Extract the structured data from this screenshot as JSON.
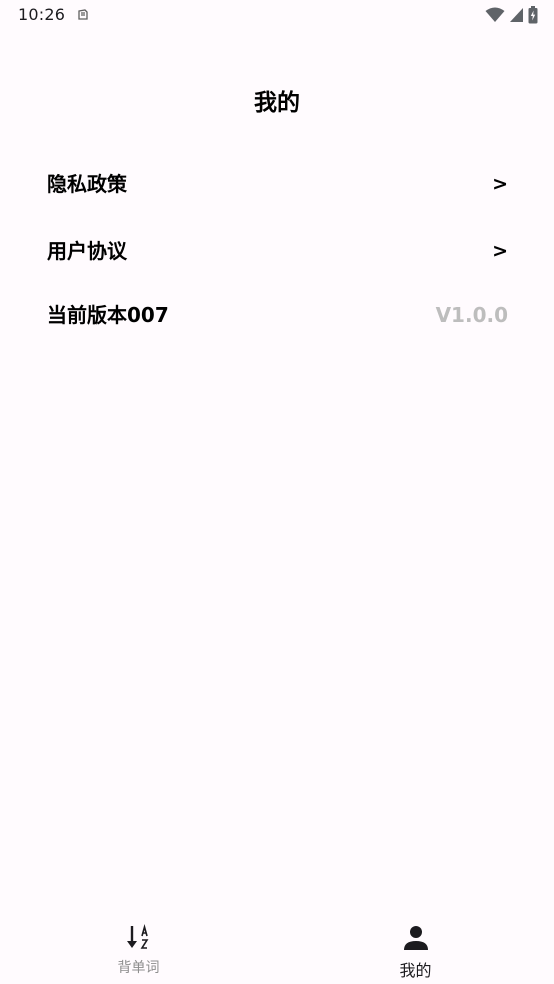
{
  "status_bar": {
    "time": "10:26",
    "icons": [
      "notification-icon",
      "wifi-icon",
      "signal-icon",
      "battery-icon"
    ]
  },
  "header": {
    "title": "我的"
  },
  "menu": {
    "privacy_policy": {
      "label": "隐私政策",
      "arrow": ">"
    },
    "user_agreement": {
      "label": "用户协议",
      "arrow": ">"
    },
    "version": {
      "label": "当前版本007",
      "value": "V1.0.0"
    }
  },
  "bottom_nav": {
    "items": [
      {
        "label": "背单词",
        "icon": "sort-az-icon",
        "active": false
      },
      {
        "label": "我的",
        "icon": "person-icon",
        "active": true
      }
    ]
  },
  "colors": {
    "background": "#fffbfe",
    "text": "#000000",
    "muted": "#bdbdbd",
    "nav_inactive": "#8e8e8e"
  }
}
